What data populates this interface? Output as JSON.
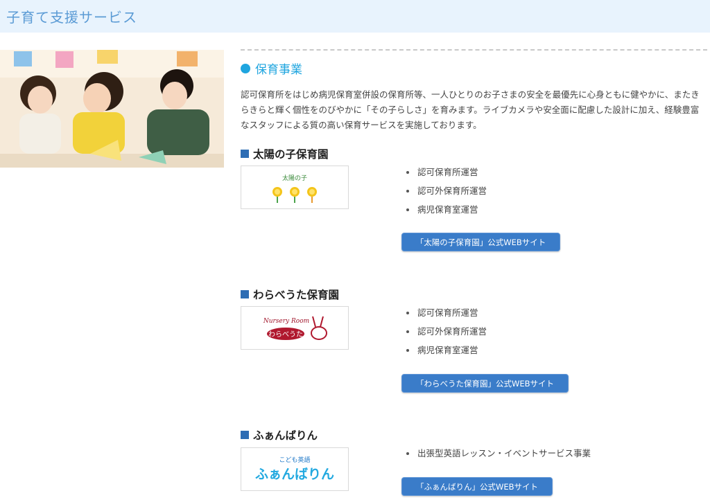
{
  "header": {
    "title": "子育て支援サービス"
  },
  "section": {
    "heading": "保育事業",
    "intro": "認可保育所をはじめ病児保育室併設の保育所等、一人ひとりのお子さまの安全を最優先に心身ともに健やかに、またきらきらと輝く個性をのびやかに「その子らしさ」を育みます。ライブカメラや安全面に配慮した設計に加え、経験豊富なスタッフによる質の高い保育サービスを実施しております。"
  },
  "facilities": [
    {
      "name": "太陽の子保育園",
      "logo_text": "太陽の子",
      "services": [
        "認可保育所運営",
        "認可外保育所運営",
        "病児保育室運営"
      ],
      "button": "「太陽の子保育園」公式WEBサイト"
    },
    {
      "name": "わらべうた保育園",
      "logo_text_top": "Nursery Room",
      "logo_text_main": "わらべうた",
      "services": [
        "認可保育所運営",
        "認可外保育所運営",
        "病児保育室運営"
      ],
      "button": "「わらべうた保育園」公式WEBサイト"
    },
    {
      "name": "ふぁんばりん",
      "logo_text_top": "こども英語",
      "logo_text_main": "ふぁんばりん",
      "services": [
        "出張型英語レッスン・イベントサービス事業"
      ],
      "button": "「ふぁんばりん」公式WEBサイト"
    }
  ],
  "colors": {
    "accent": "#1fa5df",
    "button": "#3a7cc9",
    "square": "#2e6db4",
    "header_bg": "#e8f3fd"
  }
}
